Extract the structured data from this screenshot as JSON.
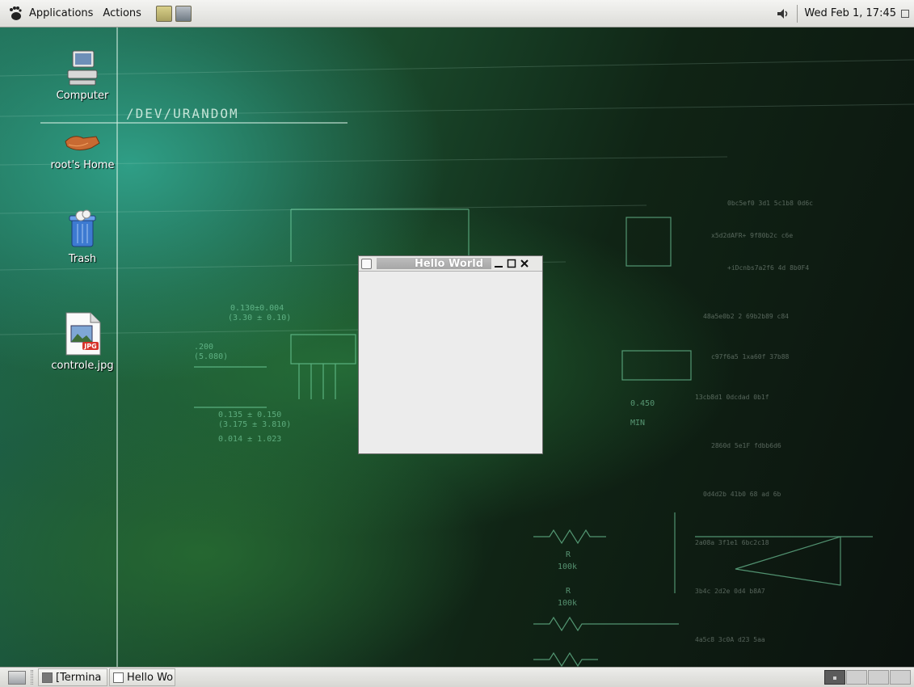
{
  "top_panel": {
    "menus": [
      "Applications",
      "Actions"
    ],
    "clock": "Wed Feb  1, 17:45"
  },
  "desktop": {
    "wallpaper_text": "/DEV/URANDOM",
    "icons": [
      {
        "label": "Computer",
        "icon": "computer-icon"
      },
      {
        "label": "root's Home",
        "icon": "home-folder-icon"
      },
      {
        "label": "Trash",
        "icon": "trash-icon"
      },
      {
        "label": "controle.jpg",
        "icon": "jpg-file-icon"
      }
    ]
  },
  "window": {
    "title": "Hello World"
  },
  "taskbar": {
    "tasks": [
      "[Termina",
      "Hello Wo"
    ],
    "workspaces": 4,
    "active_workspace": 1
  },
  "colors": {
    "panel": "#dededa",
    "window_bg": "#ececec",
    "desktop_accent": "#2f9e86"
  }
}
